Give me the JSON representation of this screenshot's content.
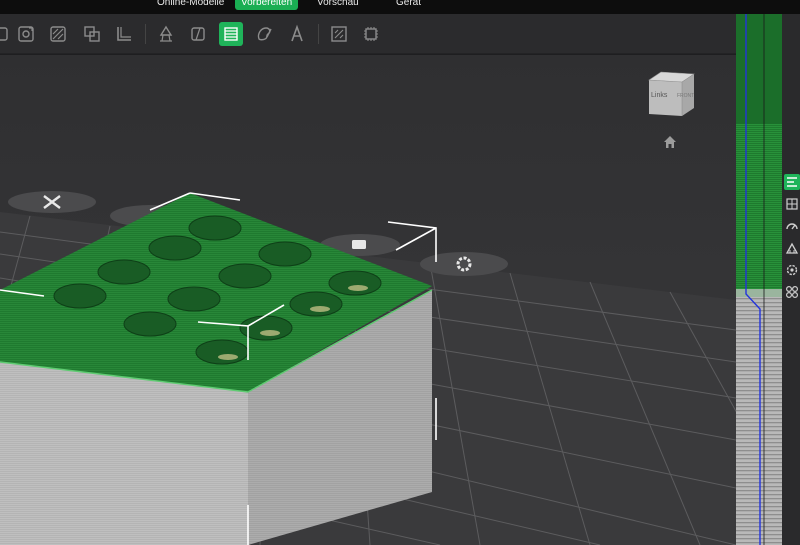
{
  "tabs": [
    {
      "label": "Online-Modelle",
      "active": false
    },
    {
      "label": "Vorbereiten",
      "active": true
    },
    {
      "label": "Vorschau",
      "active": false
    },
    {
      "label": "Gerät",
      "active": false
    }
  ],
  "toolbar": {
    "tools": [
      "add-plate-icon",
      "orient-icon",
      "auto-arrange-icon",
      "split-icon",
      "layout-icon",
      "support-paint-icon",
      "seam-icon",
      "slice-layers-icon",
      "color-paint-icon",
      "text-icon",
      "measure-icon",
      "assembly-icon"
    ],
    "active_tool": "slice-layers-icon"
  },
  "navcube": {
    "left_label": "Links",
    "front_label": "FRONT"
  },
  "colors": {
    "accent": "#1fb45a",
    "model_top": "#1e7a2e",
    "model_side": "#b8b8b8",
    "bed": "#3a3a3c",
    "grid": "#5a5a5c",
    "bounding_box": "#ffffff",
    "layer_line": "#2233dd"
  },
  "sidebar": {
    "icons": [
      "layer-slider-icon",
      "grid-icon",
      "speed-icon",
      "support-icon",
      "plate-settings-icon",
      "object-list-icon"
    ],
    "active_icon": "layer-slider-icon"
  }
}
